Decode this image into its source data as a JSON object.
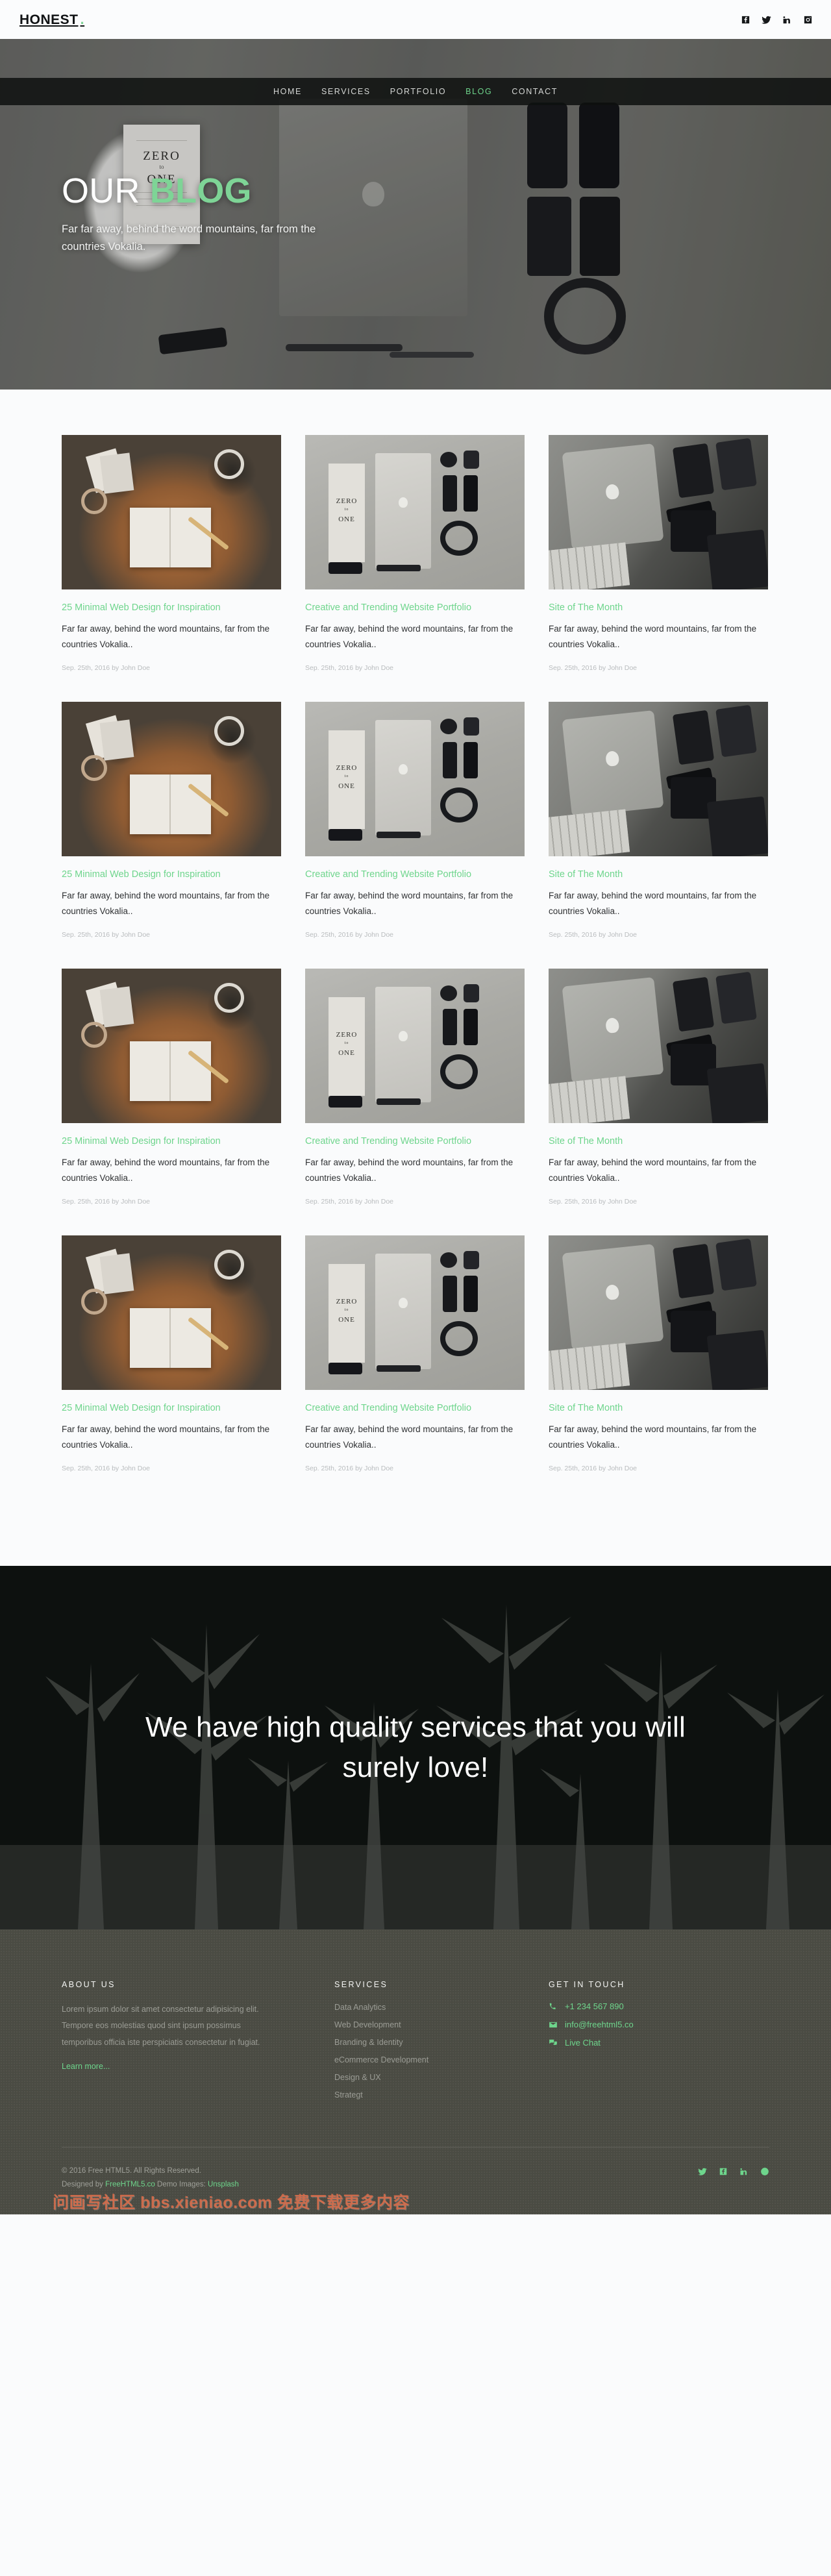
{
  "brand": {
    "name": "HONEST",
    "dot": ".",
    "accent_color": "#7ed496"
  },
  "topbar": {
    "social": [
      {
        "name": "facebook-icon",
        "label": "Facebook"
      },
      {
        "name": "twitter-icon",
        "label": "Twitter"
      },
      {
        "name": "linkedin-icon",
        "label": "LinkedIn"
      },
      {
        "name": "instagram-icon",
        "label": "Instagram"
      }
    ]
  },
  "nav": {
    "items": [
      {
        "label": "HOME",
        "active": false
      },
      {
        "label": "SERVICES",
        "active": false
      },
      {
        "label": "PORTFOLIO",
        "active": false
      },
      {
        "label": "BLOG",
        "active": true
      },
      {
        "label": "CONTACT",
        "active": false
      }
    ]
  },
  "hero": {
    "title_plain": "OUR ",
    "title_accent": "BLOG",
    "subtitle": "Far far away, behind the word mountains, far from the countries Vokalia.",
    "book_line1": "ZERO",
    "book_amp": "to",
    "book_line2": "ONE"
  },
  "blog": {
    "posts": [
      {
        "title": "25 Minimal Web Design for Inspiration",
        "excerpt": "Far far away, behind the word mountains, far from the countries Vokalia..",
        "meta": "Sep. 25th, 2016 by John Doe",
        "thumb": "orange-desk-flatlay"
      },
      {
        "title": "Creative and Trending Website Portfolio",
        "excerpt": "Far far away, behind the word mountains, far from the countries Vokalia..",
        "meta": "Sep. 25th, 2016 by John Doe",
        "thumb": "zero-to-one-flatlay"
      },
      {
        "title": "Site of The Month",
        "excerpt": "Far far away, behind the word mountains, far from the countries Vokalia..",
        "meta": "Sep. 25th, 2016 by John Doe",
        "thumb": "laptop-desk-flatlay"
      },
      {
        "title": "25 Minimal Web Design for Inspiration",
        "excerpt": "Far far away, behind the word mountains, far from the countries Vokalia..",
        "meta": "Sep. 25th, 2016 by John Doe",
        "thumb": "orange-desk-flatlay"
      },
      {
        "title": "Creative and Trending Website Portfolio",
        "excerpt": "Far far away, behind the word mountains, far from the countries Vokalia..",
        "meta": "Sep. 25th, 2016 by John Doe",
        "thumb": "zero-to-one-flatlay"
      },
      {
        "title": "Site of The Month",
        "excerpt": "Far far away, behind the word mountains, far from the countries Vokalia..",
        "meta": "Sep. 25th, 2016 by John Doe",
        "thumb": "laptop-desk-flatlay"
      },
      {
        "title": "25 Minimal Web Design for Inspiration",
        "excerpt": "Far far away, behind the word mountains, far from the countries Vokalia..",
        "meta": "Sep. 25th, 2016 by John Doe",
        "thumb": "orange-desk-flatlay"
      },
      {
        "title": "Creative and Trending Website Portfolio",
        "excerpt": "Far far away, behind the word mountains, far from the countries Vokalia..",
        "meta": "Sep. 25th, 2016 by John Doe",
        "thumb": "zero-to-one-flatlay"
      },
      {
        "title": "Site of The Month",
        "excerpt": "Far far away, behind the word mountains, far from the countries Vokalia..",
        "meta": "Sep. 25th, 2016 by John Doe",
        "thumb": "laptop-desk-flatlay"
      },
      {
        "title": "25 Minimal Web Design for Inspiration",
        "excerpt": "Far far away, behind the word mountains, far from the countries Vokalia..",
        "meta": "Sep. 25th, 2016 by John Doe",
        "thumb": "orange-desk-flatlay"
      },
      {
        "title": "Creative and Trending Website Portfolio",
        "excerpt": "Far far away, behind the word mountains, far from the countries Vokalia..",
        "meta": "Sep. 25th, 2016 by John Doe",
        "thumb": "zero-to-one-flatlay"
      },
      {
        "title": "Site of The Month",
        "excerpt": "Far far away, behind the word mountains, far from the countries Vokalia..",
        "meta": "Sep. 25th, 2016 by John Doe",
        "thumb": "laptop-desk-flatlay"
      }
    ]
  },
  "cta": {
    "heading": "We have high quality services that you will surely love!"
  },
  "footer": {
    "about": {
      "heading": "ABOUT US",
      "body": "Lorem ipsum dolor sit amet consectetur adipisicing elit. Tempore eos molestias quod sint ipsum possimus temporibus officia iste perspiciatis consectetur in fugiat.",
      "link": "Learn more..."
    },
    "services": {
      "heading": "SERVICES",
      "items": [
        "Data Analytics",
        "Web Development",
        "Branding & Identity",
        "eCommerce Development",
        "Design & UX",
        "Strategt"
      ]
    },
    "touch": {
      "heading": "GET IN TOUCH",
      "items": [
        {
          "icon": "phone-icon",
          "label": "+1 234 567 890"
        },
        {
          "icon": "envelope-icon",
          "label": "info@freehtml5.co"
        },
        {
          "icon": "chat-icon",
          "label": "Live Chat"
        }
      ]
    },
    "copyright_line1": "© 2016 Free HTML5. All Rights Reserved.",
    "copyright_line2_prefix": "Designed by ",
    "copyright_line2_link": "FreeHTML5.co",
    "copyright_line2_mid": " Demo Images: ",
    "copyright_line2_link2": "Unsplash",
    "social": [
      {
        "name": "twitter-icon",
        "label": "Twitter"
      },
      {
        "name": "facebook-icon",
        "label": "Facebook"
      },
      {
        "name": "linkedin-icon",
        "label": "LinkedIn"
      },
      {
        "name": "dribbble-icon",
        "label": "Dribbble"
      }
    ],
    "watermark": "问画写社区 bbs.xieniao.com 免费下载更多内容"
  }
}
